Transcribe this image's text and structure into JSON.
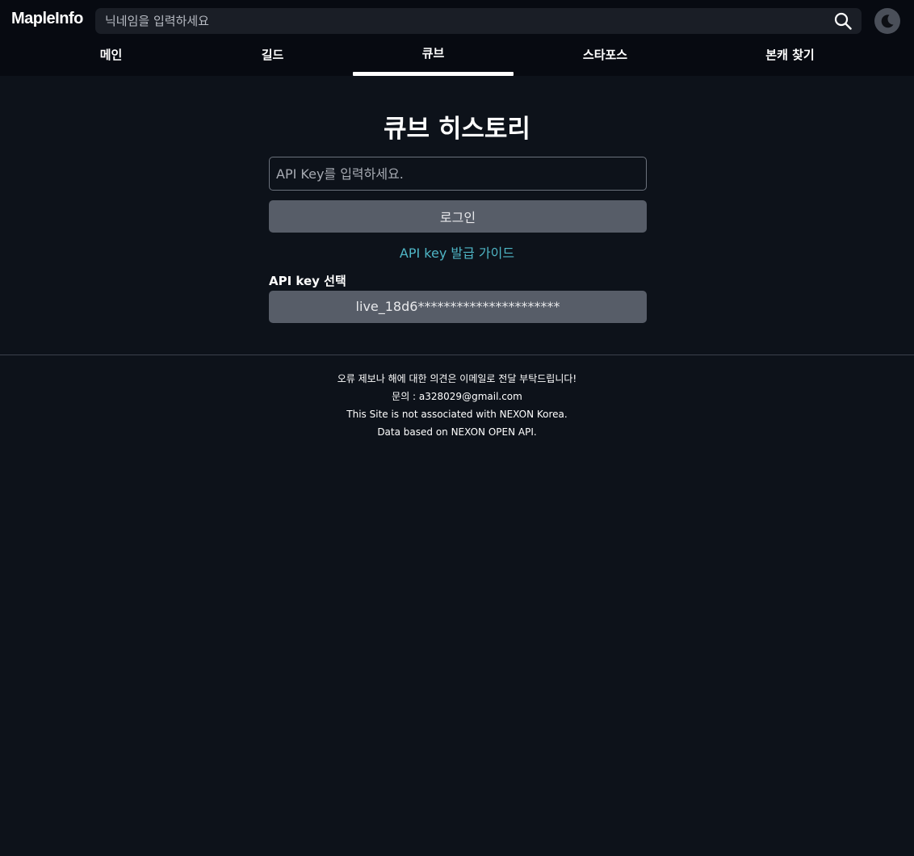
{
  "header": {
    "logo": "MapleInfo",
    "search_placeholder": "닉네임을 입력하세요",
    "search_icon": "search-icon",
    "theme_icon": "moon-icon"
  },
  "nav": {
    "tabs": [
      {
        "label": "메인"
      },
      {
        "label": "길드"
      },
      {
        "label": "큐브",
        "active": true
      },
      {
        "label": "스타포스"
      },
      {
        "label": "본캐 찾기"
      }
    ]
  },
  "main": {
    "title": "큐브 히스토리",
    "apikey_placeholder": "API Key를 입력하세요.",
    "login_label": "로그인",
    "guide_link": "API key 발급 가이드",
    "select_label": "API key 선택",
    "selected_key": "live_18d6**********************"
  },
  "footer": {
    "lines": [
      "오류 제보나 해에 대한 의견은 이메일로 전달 부탁드립니다!",
      "문의 : a328029@gmail.com",
      "This Site is not associated with NEXON Korea.",
      "Data based on NEXON OPEN API."
    ]
  },
  "colors": {
    "background": "#0d121a",
    "topbar": "#070a11",
    "accent_link": "#4fb6c6",
    "button": "#575d68"
  }
}
